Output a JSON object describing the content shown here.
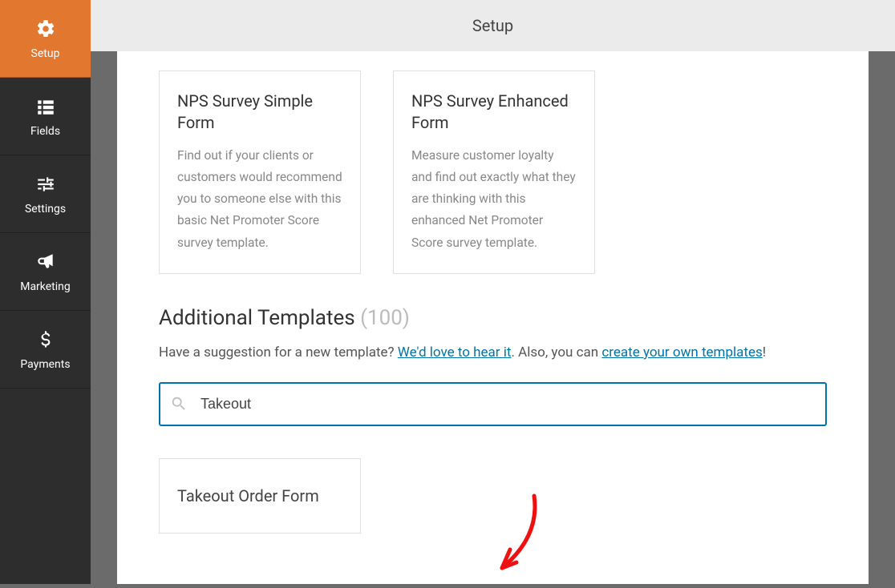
{
  "sidebar": {
    "items": [
      {
        "label": "Setup",
        "active": true
      },
      {
        "label": "Fields",
        "active": false
      },
      {
        "label": "Settings",
        "active": false
      },
      {
        "label": "Marketing",
        "active": false
      },
      {
        "label": "Payments",
        "active": false
      }
    ]
  },
  "topbar": {
    "title": "Setup"
  },
  "cards": [
    {
      "title": "NPS Survey Simple Form",
      "desc": "Find out if your clients or customers would recommend you to someone else with this basic Net Promoter Score survey template."
    },
    {
      "title": "NPS Survey Enhanced Form",
      "desc": "Measure customer loyalty and find out exactly what they are thinking with this enhanced Net Promoter Score survey template."
    }
  ],
  "additional": {
    "heading": "Additional Templates",
    "count": "(100)",
    "suggestion_pre": "Have a suggestion for a new template? ",
    "suggestion_link1": "We'd love to hear it",
    "suggestion_mid": ". Also, you can ",
    "suggestion_link2": "create your own templates",
    "suggestion_post": "!"
  },
  "search": {
    "value": "Takeout",
    "placeholder": ""
  },
  "results": [
    {
      "title": "Takeout Order Form"
    }
  ]
}
